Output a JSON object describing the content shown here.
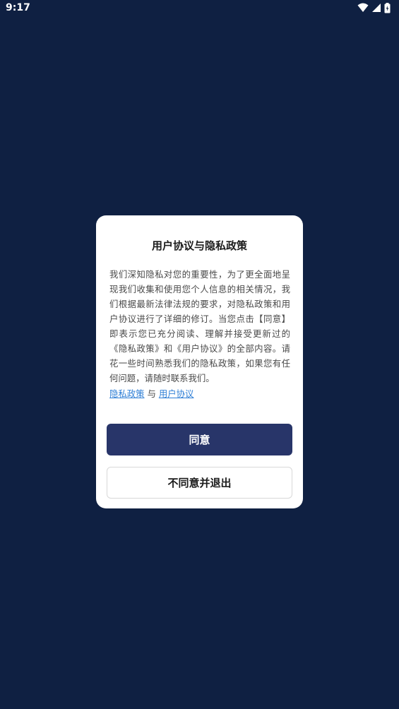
{
  "status_bar": {
    "time": "9:17",
    "icons": [
      "wifi-icon",
      "signal-icon",
      "battery-icon"
    ]
  },
  "dialog": {
    "title": "用户协议与隐私政策",
    "body": "我们深知隐私对您的重要性，为了更全面地呈现我们收集和使用您个人信息的相关情况，我们根据最新法律法规的要求，对隐私政策和用户协议进行了详细的修订。当您点击【同意】即表示您已充分阅读、理解并接受更新过的《隐私政策》和《用户协议》的全部内容。请花一些时间熟悉我们的隐私政策，如果您有任何问题，请随时联系我们。",
    "privacy_link": "隐私政策",
    "connector": "与",
    "terms_link": "用户协议",
    "agree_button": "同意",
    "disagree_button": "不同意并退出"
  },
  "colors": {
    "background": "#0f2042",
    "primary_button": "#283569",
    "link": "#2f7fd6"
  }
}
